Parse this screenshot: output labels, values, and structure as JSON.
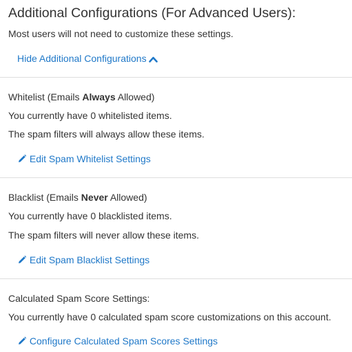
{
  "header": {
    "title": "Additional Configurations (For Advanced Users):",
    "subtitle": "Most users will not need to customize these settings.",
    "toggle_link": "Hide Additional Configurations",
    "toggle_icon": "chevron-up-icon"
  },
  "whitelist": {
    "heading_prefix": "Whitelist (Emails ",
    "heading_bold": "Always",
    "heading_suffix": " Allowed)",
    "count_text": "You currently have 0 whitelisted items.",
    "description": "The spam filters will always allow these items.",
    "edit_link": "Edit Spam Whitelist Settings",
    "edit_icon": "pencil-icon"
  },
  "blacklist": {
    "heading_prefix": "Blacklist (Emails ",
    "heading_bold": "Never",
    "heading_suffix": " Allowed)",
    "count_text": "You currently have 0 blacklisted items.",
    "description": "The spam filters will never allow these items.",
    "edit_link": "Edit Spam Blacklist Settings",
    "edit_icon": "pencil-icon"
  },
  "calculated": {
    "heading": "Calculated Spam Score Settings:",
    "count_text": "You currently have 0 calculated spam score customizations on this account.",
    "edit_link": "Configure Calculated Spam Scores Settings",
    "edit_icon": "pencil-icon"
  },
  "colors": {
    "link": "#1f78c8",
    "text": "#333333",
    "divider": "#dddddd"
  }
}
